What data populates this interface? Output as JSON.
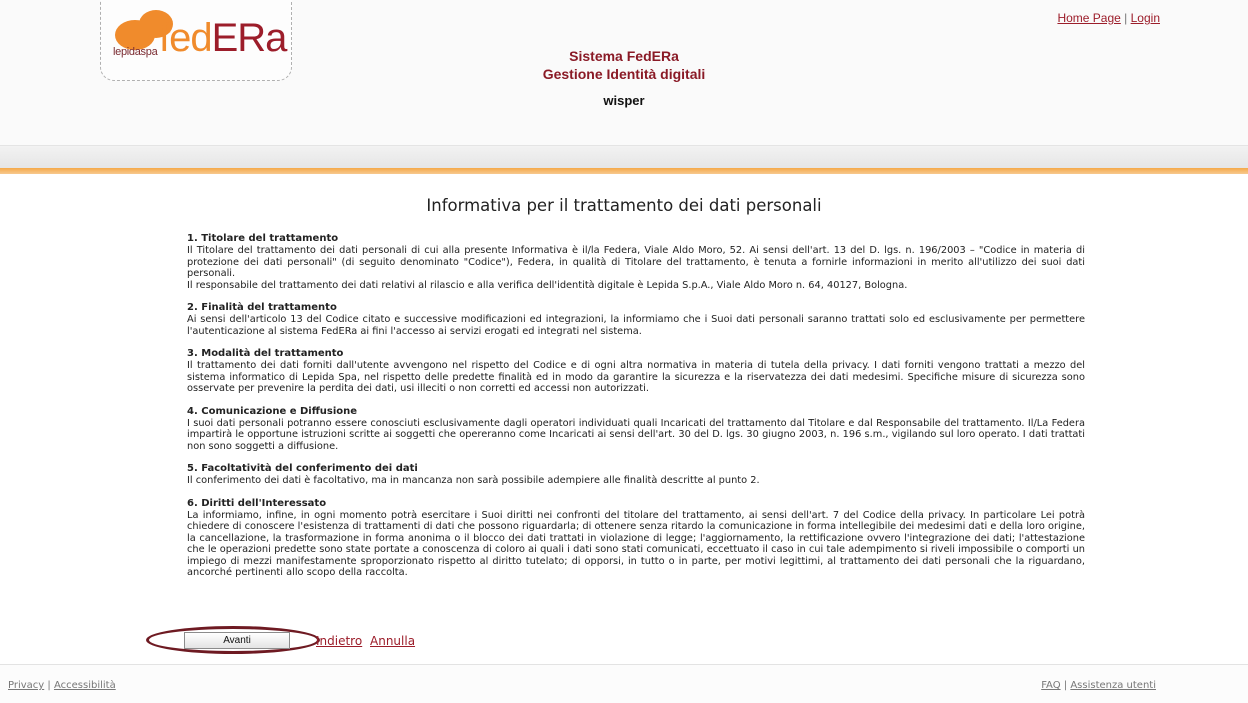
{
  "header": {
    "logo_text_lepida": "lepidaspa",
    "logo_text_fed": "fed",
    "logo_text_era": "ERa",
    "system_title": "Sistema FedERa",
    "system_subtitle": "Gestione Identità digitali",
    "user_name": "wisper",
    "top_links": {
      "home": "Home Page",
      "separator": "|",
      "login": "Login"
    }
  },
  "colors": {
    "accent_orange": "#f08b2c",
    "brand_red": "#9c1d2a"
  },
  "main": {
    "title": "Informativa per il trattamento dei dati personali",
    "sections": [
      {
        "heading": "1. Titolare del trattamento",
        "paragraphs": [
          "Il Titolare del trattamento dei dati personali di cui alla presente Informativa è il/la Federa, Viale Aldo Moro, 52. Ai sensi dell'art. 13 del D. lgs. n. 196/2003 – \"Codice in materia di protezione dei dati personali\" (di seguito denominato \"Codice\"), Federa, in qualità di Titolare del trattamento, è tenuta a fornirle informazioni in merito all'utilizzo dei suoi dati personali.",
          "Il responsabile del trattamento dei dati relativi al rilascio e alla verifica dell'identità digitale è Lepida S.p.A., Viale Aldo Moro n. 64, 40127, Bologna."
        ]
      },
      {
        "heading": "2. Finalità del trattamento",
        "paragraphs": [
          "Ai sensi dell'articolo 13 del Codice citato e successive modificazioni ed integrazioni, la informiamo che i Suoi dati personali saranno trattati solo ed esclusivamente per permettere l'autenticazione al sistema FedERa ai fini l'accesso ai servizi erogati ed integrati nel sistema."
        ]
      },
      {
        "heading": "3. Modalità del trattamento",
        "paragraphs": [
          "Il trattamento dei dati forniti dall'utente avvengono nel rispetto del Codice e di ogni altra normativa in materia di tutela della privacy. I dati forniti vengono trattati a mezzo del sistema informatico di Lepida Spa, nel rispetto delle predette finalità ed in modo da garantire la sicurezza e la riservatezza dei dati medesimi. Specifiche misure di sicurezza sono osservate per prevenire la perdita dei dati, usi illeciti o non corretti ed accessi non autorizzati."
        ]
      },
      {
        "heading": "4. Comunicazione e Diffusione",
        "paragraphs": [
          "I suoi dati personali potranno essere conosciuti esclusivamente dagli operatori individuati quali Incaricati del trattamento dal Titolare e dal Responsabile del trattamento. Il/La Federa impartirà le opportune istruzioni scritte ai soggetti che opereranno come Incaricati ai sensi dell'art. 30 del D. lgs. 30 giugno 2003, n. 196 s.m., vigilando sul loro operato. I dati trattati non sono soggetti a diffusione."
        ]
      },
      {
        "heading": "5. Facoltatività del conferimento dei dati",
        "paragraphs": [
          "Il conferimento dei dati è facoltativo, ma in mancanza non sarà possibile adempiere alle finalità descritte al punto 2."
        ]
      },
      {
        "heading": "6. Diritti dell'Interessato",
        "paragraphs": [
          "La informiamo, infine, in ogni momento potrà esercitare i Suoi diritti nei confronti del titolare del trattamento, ai sensi dell'art. 7 del Codice della privacy. In particolare Lei potrà chiedere di conoscere l'esistenza di trattamenti di dati che possono riguardarla; di ottenere senza ritardo la comunicazione in forma intellegibile dei medesimi dati e della loro origine, la cancellazione, la trasformazione in forma anonima o il blocco dei dati trattati in violazione di legge; l'aggiornamento, la rettificazione ovvero l'integrazione dei dati; l'attestazione che le operazioni predette sono state portate a conoscenza di coloro ai quali i dati sono stati comunicati, eccettuato il caso in cui tale adempimento si riveli impossibile o comporti un impiego di mezzi manifestamente sproporzionato rispetto al diritto tutelato; di opporsi, in tutto o in parte, per motivi legittimi, al trattamento dei dati personali che la riguardano, ancorché pertinenti allo scopo della raccolta."
        ]
      }
    ],
    "actions": {
      "next_label": "Avanti",
      "back_label": "Indietro",
      "cancel_label": "Annulla"
    }
  },
  "footer": {
    "left": {
      "privacy": "Privacy",
      "separator": "|",
      "accessibility": "Accessibilità"
    },
    "right": {
      "faq": "FAQ",
      "separator": "|",
      "support": "Assistenza utenti"
    }
  }
}
